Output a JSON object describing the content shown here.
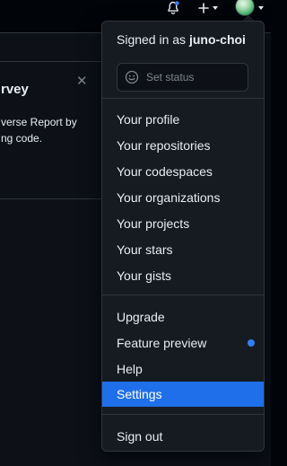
{
  "header": {
    "icons": [
      "bell-icon",
      "plus-icon",
      "avatar"
    ]
  },
  "survey": {
    "title": "rvey",
    "line1": "verse Report by",
    "line2": "ng code.",
    "close_icon": "close-icon"
  },
  "menu": {
    "signed_in_prefix": "Signed in as",
    "username": "juno-choi",
    "status": {
      "placeholder": "Set status",
      "icon": "smiley-icon"
    },
    "group1": [
      {
        "label": "Your profile"
      },
      {
        "label": "Your repositories"
      },
      {
        "label": "Your codespaces"
      },
      {
        "label": "Your organizations"
      },
      {
        "label": "Your projects"
      },
      {
        "label": "Your stars"
      },
      {
        "label": "Your gists"
      }
    ],
    "group2": [
      {
        "label": "Upgrade"
      },
      {
        "label": "Feature preview"
      },
      {
        "label": "Help"
      },
      {
        "label": "Settings"
      }
    ],
    "sign_out": "Sign out"
  },
  "colors": {
    "active_bg": "#1f6feb",
    "dot": "#2f81f7",
    "menu_bg": "#161b22",
    "page_bg": "#0d1117"
  }
}
